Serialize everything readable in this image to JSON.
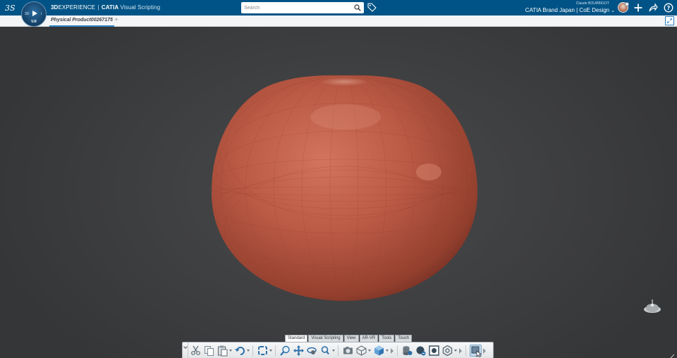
{
  "header": {
    "brand_strong": "3D",
    "brand_experience": "EXPERIENCE",
    "brand_sep": "|",
    "brand_product": "CATIA",
    "brand_app": "Visual Scripting",
    "compass_label": "V.R",
    "compass_left": "3D",
    "compass_right": "i",
    "search_placeholder": "Search",
    "user_name": "Claude BOURBIGOT",
    "tenant": "CATIA Brand Japan | CoE Design",
    "icons": [
      "ds-logo-icon",
      "compass-icon",
      "search-icon",
      "tag-icon",
      "avatar",
      "add-icon",
      "share-icon",
      "help-icon"
    ]
  },
  "tabs": {
    "active_tab": "Physical Product00267175",
    "add_label": "+"
  },
  "viewport": {
    "object": "tomato-shaped surface",
    "object_color": "#b8533f",
    "background_color": "#3b3c3e"
  },
  "action_bar": {
    "tabs": [
      "Standard",
      "Visual Scripting",
      "View",
      "AR-VR",
      "Tools",
      "Touch"
    ],
    "active_tab_index": 0,
    "buttons": [
      "cut-icon",
      "copy-icon",
      "paste-icon",
      "undo-icon",
      "update-icon",
      "zoom-icon",
      "pan-icon",
      "rotate-icon",
      "zoom-area-icon",
      "capture-icon",
      "view-mode-icon",
      "cube-view-icon",
      "product-icon",
      "publish-icon",
      "snapshot-icon",
      "settings-gear-icon",
      "select-icon"
    ]
  },
  "colors": {
    "topbar": "#005386",
    "accent": "#2c7fc0",
    "tab_bar": "#f4f5f6"
  }
}
